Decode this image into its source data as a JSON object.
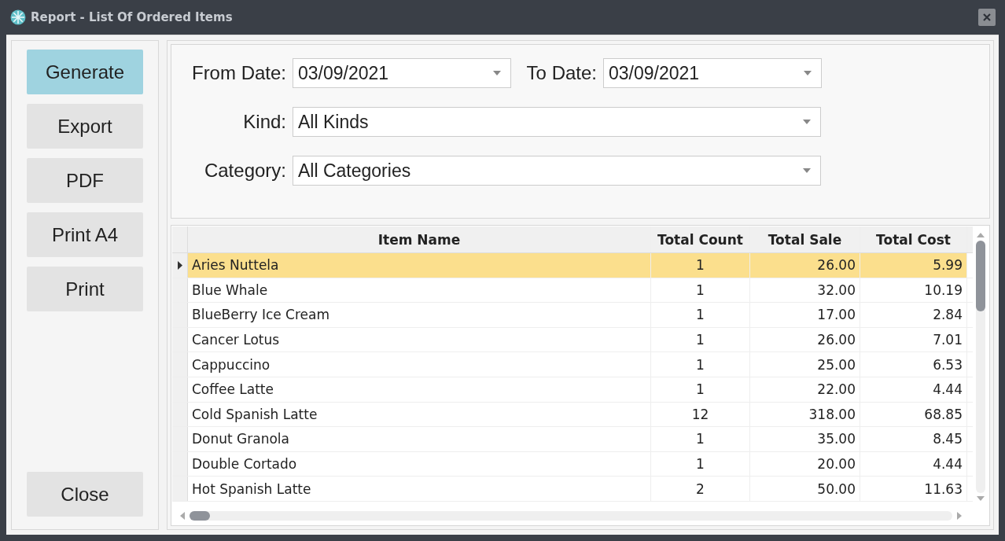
{
  "window": {
    "title": "Report - List Of Ordered Items"
  },
  "actions": [
    {
      "label": "Generate",
      "selected": true
    },
    {
      "label": "Export",
      "selected": false
    },
    {
      "label": "PDF",
      "selected": false
    },
    {
      "label": "Print A4",
      "selected": false
    },
    {
      "label": "Print",
      "selected": false
    }
  ],
  "close_button": {
    "label": "Close"
  },
  "filters": {
    "from_date": {
      "label": "From Date:",
      "value": "03/09/2021"
    },
    "to_date": {
      "label": "To Date:",
      "value": "03/09/2021"
    },
    "kind": {
      "label": "Kind:",
      "value": "All Kinds"
    },
    "category": {
      "label": "Category:",
      "value": "All Categories"
    }
  },
  "table": {
    "columns": [
      "Item Name",
      "Total Count",
      "Total Sale",
      "Total Cost"
    ],
    "rows": [
      {
        "cells": [
          "Aries Nuttela",
          "1",
          "26.00",
          "5.99"
        ],
        "selected": true
      },
      {
        "cells": [
          "Blue Whale",
          "1",
          "32.00",
          "10.19"
        ],
        "selected": false
      },
      {
        "cells": [
          "BlueBerry Ice Cream",
          "1",
          "17.00",
          "2.84"
        ],
        "selected": false
      },
      {
        "cells": [
          "Cancer Lotus",
          "1",
          "26.00",
          "7.01"
        ],
        "selected": false
      },
      {
        "cells": [
          "Cappuccino",
          "1",
          "25.00",
          "6.53"
        ],
        "selected": false
      },
      {
        "cells": [
          "Coffee Latte",
          "1",
          "22.00",
          "4.44"
        ],
        "selected": false
      },
      {
        "cells": [
          "Cold Spanish Latte",
          "12",
          "318.00",
          "68.85"
        ],
        "selected": false
      },
      {
        "cells": [
          "Donut Granola",
          "1",
          "35.00",
          "8.45"
        ],
        "selected": false
      },
      {
        "cells": [
          "Double Cortado",
          "1",
          "20.00",
          "4.44"
        ],
        "selected": false
      },
      {
        "cells": [
          "Hot Spanish Latte",
          "2",
          "50.00",
          "11.63"
        ],
        "selected": false
      }
    ]
  }
}
